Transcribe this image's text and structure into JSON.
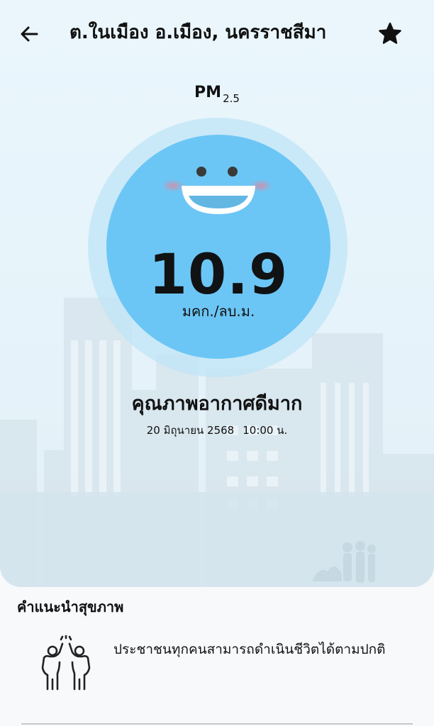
{
  "header": {
    "title": "ต.ในเมือง อ.เมือง, นครราชสีมา",
    "back_icon": "arrow-left-icon",
    "favorite_icon": "star-icon"
  },
  "reading": {
    "pollutant": "PM",
    "pollutant_subscript": "2.5",
    "value": "10.9",
    "unit": "มคก./ลบ.ม.",
    "face_icon": "smiling-face-icon",
    "face_color": "#6cc6f5"
  },
  "status": {
    "label": "คุณภาพอากาศดีมาก",
    "date": "20 มิถุนายน 2568",
    "time": "10:00 น."
  },
  "advice": {
    "title": "คำแนะนำสุขภาพ",
    "icon": "high-five-people-icon",
    "text": "ประชาชนทุกคนสามารถดำเนินชีวิตได้ตามปกติ"
  }
}
